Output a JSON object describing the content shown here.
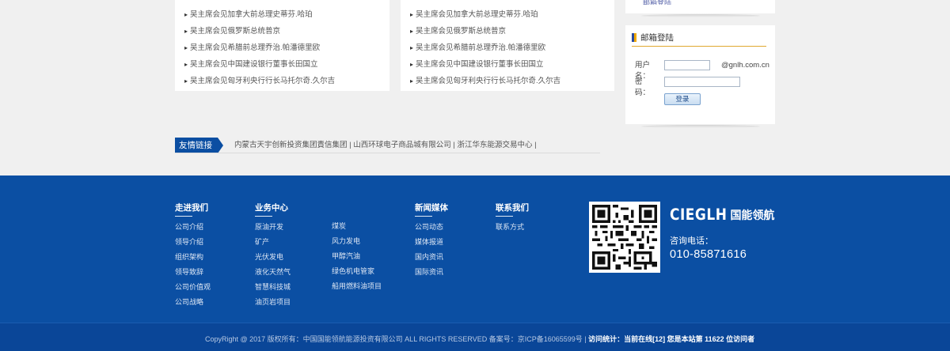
{
  "news_left": [
    "吴主席会见加拿大前总理史蒂芬.哈珀",
    "吴主席会见俄罗斯总统普京",
    "吴主席会见希腊前总理乔治.帕潘德里欧",
    "吴主席会见中国建设银行董事长田国立",
    "吴主席会见匈牙利央行行长马托尔奇.久尔吉"
  ],
  "news_right": [
    "吴主席会见加拿大前总理史蒂芬.哈珀",
    "吴主席会见俄罗斯总统普京",
    "吴主席会见希腊前总理乔治.帕潘德里欧",
    "吴主席会见中国建设银行董事长田国立",
    "吴主席会见匈牙利央行行长马托尔奇.久尔吉"
  ],
  "mail": {
    "top_link": "邮箱登陆",
    "title": "邮箱登陆",
    "username_label": "用户名：",
    "username_value": "",
    "domain_suffix": "@gnlh.com.cn",
    "password_label": "密　码：",
    "password_value": "",
    "login_button": "登录"
  },
  "friend": {
    "label": "友情链接",
    "links": "内蒙古天宇创新投资集团責信集团 | 山西环球电子商品城有限公司 | 浙江华东能源交易中心 |"
  },
  "footer": {
    "col1": {
      "title": "走进我们",
      "items": [
        "公司介绍",
        "领导介绍",
        "组织架构",
        "领导致辞",
        "公司价值观",
        "公司战略"
      ]
    },
    "col2": {
      "title": "业务中心",
      "items": [
        "原油开发",
        "矿产",
        "光伏发电",
        "液化天然气",
        "智慧科技城",
        "油页岩项目"
      ]
    },
    "col3": {
      "items": [
        "煤炭",
        "风力发电",
        "甲醇汽油",
        "绿色机电管家",
        "船用燃料油项目"
      ]
    },
    "col4": {
      "title": "新闻媒体",
      "items": [
        "公司动态",
        "媒体报道",
        "国内资讯",
        "国际资讯"
      ]
    },
    "col5": {
      "title": "联系我们",
      "items": [
        "联系方式"
      ]
    },
    "brand_en": "CIEGLH",
    "brand_cn": "国能领航",
    "consult_label": "咨询电话：",
    "consult_phone": "010-85871616",
    "copyright": "CopyRight @ 2017 版权所有：中国国能领航能源投资有限公司 ALL RIGHTS RESERVED 备案号：京ICP备16065599号 |",
    "stats": "访问统计：当前在线[12] 您是本站第 11622 位访问者"
  },
  "colors": {
    "footer_bg": "#0b4fa3",
    "accent_blue": "#0b4ea2",
    "accent_gold": "#e0a830"
  },
  "icons": [
    "qr-code-icon",
    "mail-bar-icon"
  ]
}
